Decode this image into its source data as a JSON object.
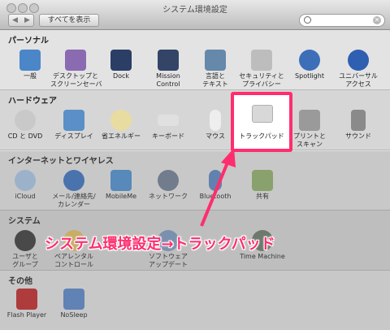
{
  "window": {
    "title": "システム環境設定",
    "show_all": "すべてを表示",
    "back": "◀",
    "forward": "▶",
    "search_clear": "✕"
  },
  "sections": {
    "personal": {
      "title": "パーソナル",
      "items": [
        "一般",
        "デスクトップと\nスクリーンセーバ",
        "Dock",
        "Mission\nControl",
        "言語と\nテキスト",
        "セキュリティと\nプライバシー",
        "Spotlight",
        "ユニバーサル\nアクセス"
      ]
    },
    "hardware": {
      "title": "ハードウェア",
      "items": [
        "CD と DVD",
        "ディスプレイ",
        "省エネルギー",
        "キーボード",
        "マウス",
        "トラックパッド",
        "プリントと\nスキャン",
        "サウンド"
      ]
    },
    "internet": {
      "title": "インターネットとワイヤレス",
      "items": [
        "iCloud",
        "メール/連絡先/\nカレンダー",
        "MobileMe",
        "ネットワーク",
        "Bluetooth",
        "共有"
      ]
    },
    "system": {
      "title": "システム",
      "items": [
        "ユーザと\nグループ",
        "ペアレンタル\nコントロール",
        "ソフトウェア\nアップデート",
        "Time Machine"
      ]
    },
    "other": {
      "title": "その他",
      "items": [
        "Flash Player",
        "NoSleep"
      ]
    }
  },
  "annotation": {
    "caption": "システム環境設定→トラックパッド",
    "color": "#ff2d6e"
  }
}
